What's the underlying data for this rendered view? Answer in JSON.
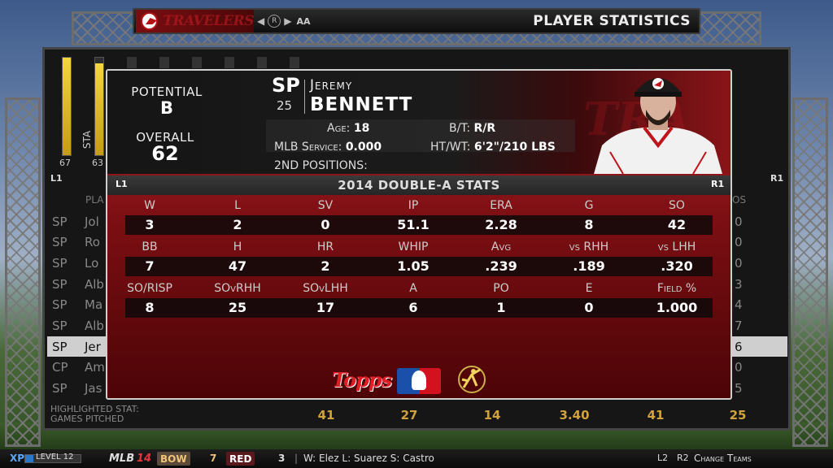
{
  "header": {
    "logo_text": "TRAVELERS",
    "nav_button": "R",
    "level": "AA",
    "screen_title": "PLAYER STATISTICS"
  },
  "background_panel": {
    "stamina_label": "STA",
    "meter_values": [
      "67",
      "63"
    ],
    "l1_label": "L1",
    "r1_label": "R1",
    "players_col_header": "PLA",
    "right_col_header": "OS",
    "rows": [
      {
        "pos": "SP",
        "name": "Jol",
        "end": "0",
        "highlighted": false
      },
      {
        "pos": "SP",
        "name": "Ro",
        "end": "0",
        "highlighted": false
      },
      {
        "pos": "SP",
        "name": "Lo",
        "end": "0",
        "highlighted": false
      },
      {
        "pos": "SP",
        "name": "Alb",
        "end": "3",
        "highlighted": false
      },
      {
        "pos": "SP",
        "name": "Ma",
        "end": "4",
        "highlighted": false
      },
      {
        "pos": "SP",
        "name": "Alb",
        "end": "7",
        "highlighted": false
      },
      {
        "pos": "SP",
        "name": "Jer",
        "end": "6",
        "highlighted": true
      },
      {
        "pos": "CP",
        "name": "Am",
        "end": "0",
        "highlighted": false
      },
      {
        "pos": "SP",
        "name": "Jas",
        "end": "5",
        "highlighted": false
      }
    ],
    "highlighted_stat_label": "HIGHLIGHTED STAT:",
    "highlighted_stat_name": "GAMES PITCHED",
    "bottom_values": [
      "41",
      "27",
      "14",
      "3.40",
      "41",
      "25"
    ]
  },
  "player": {
    "potential_label": "POTENTIAL",
    "potential": "B",
    "overall_label": "OVERALL",
    "overall": "62",
    "position": "SP",
    "number": "25",
    "first_name": "Jeremy",
    "last_name": "BENNETT",
    "age_label": "Age:",
    "age": "18",
    "bt_label": "B/T:",
    "bt": "R/R",
    "service_label": "MLB Service:",
    "service": "0.000",
    "htwt_label": "HT/WT:",
    "htwt": "6'2\"/210 LBS",
    "second_positions_label": "2ND POSITIONS:",
    "second_positions": ""
  },
  "stats": {
    "title": "2014 DOUBLE-A STATS",
    "l1": "L1",
    "r1": "R1",
    "rows": [
      {
        "headers": [
          "W",
          "L",
          "SV",
          "IP",
          "ERA",
          "G",
          "SO"
        ],
        "values": [
          "3",
          "2",
          "0",
          "51.1",
          "2.28",
          "8",
          "42"
        ]
      },
      {
        "headers": [
          "BB",
          "H",
          "HR",
          "WHIP",
          "Avg",
          "vs RHH",
          "vs LHH"
        ],
        "values": [
          "7",
          "47",
          "2",
          "1.05",
          ".239",
          ".189",
          ".320"
        ]
      },
      {
        "headers": [
          "SO/RISP",
          "SOvRHH",
          "SOvLHH",
          "A",
          "PO",
          "E",
          "Field %"
        ],
        "values": [
          "8",
          "25",
          "17",
          "6",
          "1",
          "0",
          "1.000"
        ]
      }
    ]
  },
  "sponsors": {
    "topps": "Topps",
    "mlb_icon": "mlb-logo-icon",
    "players_icon": "players-association-icon"
  },
  "ticker": {
    "xp": "XP",
    "level": "LEVEL 12",
    "mlb": "MLB",
    "mlb_year": "14",
    "team1": "BOW",
    "score1": "7",
    "team2": "RED",
    "score2": "3",
    "pitchers": "W: Elez L: Suarez S: Castro",
    "l2": "L2",
    "r2": "R2",
    "change_teams": "Change Teams",
    "xp_fraction": 0.15
  },
  "colors": {
    "accent_red": "#b9262b",
    "highlight_gold": "#d2a23d",
    "meter_yellow": "#f5d63b"
  }
}
